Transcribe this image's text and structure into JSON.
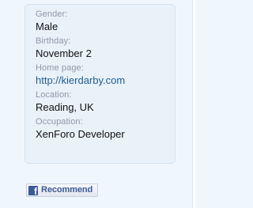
{
  "profile": {
    "fields": [
      {
        "label": "Gender:",
        "value": "Male"
      },
      {
        "label": "Birthday:",
        "value": "November 2"
      },
      {
        "label": "Home page:",
        "value": "http://kierdarby.com"
      },
      {
        "label": "Location:",
        "value": "Reading, UK"
      },
      {
        "label": "Occupation:",
        "value": "XenForo Developer"
      }
    ]
  },
  "social": {
    "recommend_label": "Recommend",
    "icon_glyph": "f",
    "brand_color": "#3b5998"
  },
  "colors": {
    "link": "#1f5d8f",
    "label": "#8c9aa8",
    "card_background": "#e9f1f9"
  }
}
